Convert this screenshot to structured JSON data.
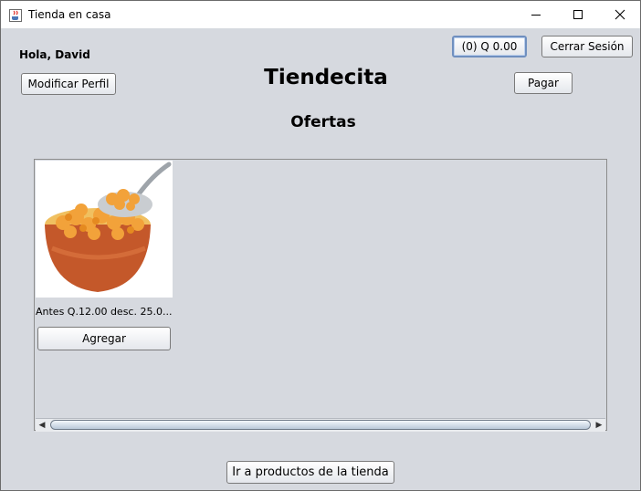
{
  "window": {
    "title": "Tienda en casa",
    "icons": {
      "app": "java-cup-icon",
      "minimize": "minimize-icon",
      "maximize": "maximize-icon",
      "close": "close-icon"
    }
  },
  "header": {
    "greeting": "Hola, David",
    "store_title": "Tiendecita",
    "section_title": "Ofertas",
    "cart_label": "(0)  Q 0.00",
    "logout_label": "Cerrar Sesión",
    "edit_profile_label": "Modificar Perfil",
    "pay_label": "Pagar"
  },
  "offers": {
    "products": [
      {
        "image": "cereal-bowl-image",
        "caption": "Antes Q.12.00 desc. 25.0...",
        "add_label": "Agregar"
      }
    ]
  },
  "footer": {
    "go_products_label": "Ir a productos de la tienda"
  },
  "colors": {
    "background": "#d6d9df",
    "titlebar": "#ffffff",
    "focus_border": "#6f8fbf"
  }
}
